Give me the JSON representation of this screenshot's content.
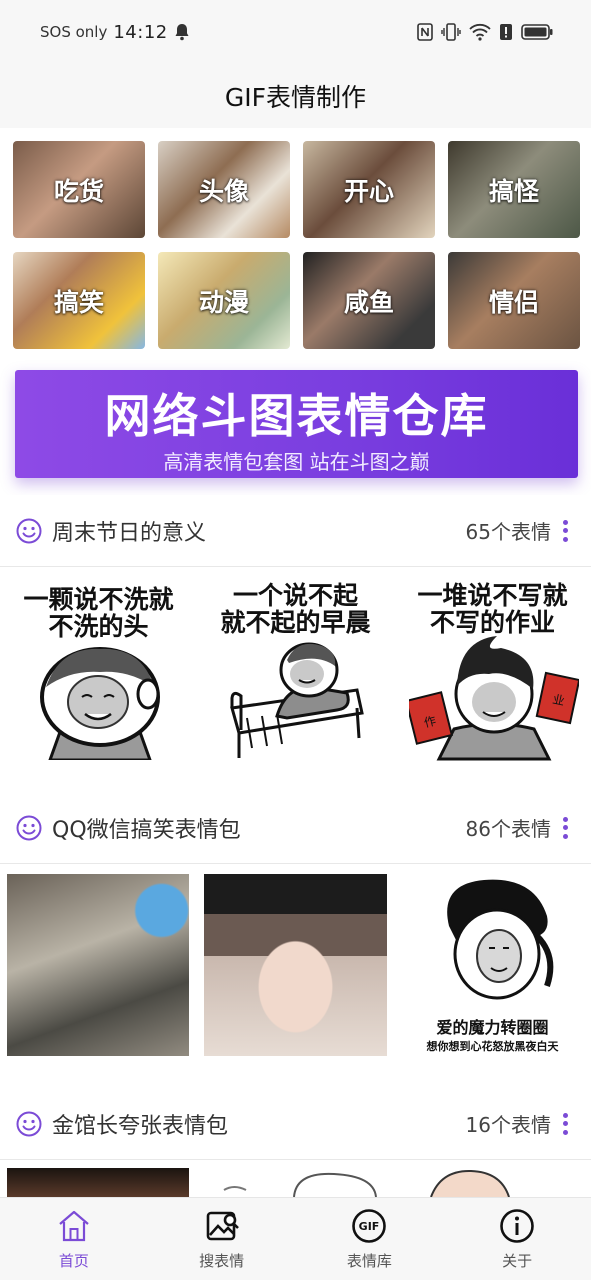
{
  "status_bar": {
    "network": "SOS only",
    "time": "14:12"
  },
  "app_title": "GIF表情制作",
  "categories": [
    {
      "label": "吃货"
    },
    {
      "label": "头像"
    },
    {
      "label": "开心"
    },
    {
      "label": "搞怪"
    },
    {
      "label": "搞笑"
    },
    {
      "label": "动漫"
    },
    {
      "label": "咸鱼"
    },
    {
      "label": "情侣"
    }
  ],
  "banner": {
    "title": "网络斗图表情仓库",
    "subtitle": "高清表情包套图 站在斗图之巅"
  },
  "sections": [
    {
      "title": "周末节日的意义",
      "count": "65个表情",
      "memes": [
        {
          "caption_1": "一颗说不洗就",
          "caption_2": "不洗的头"
        },
        {
          "caption_1": "一个说不起",
          "caption_2": "就不起的早晨"
        },
        {
          "caption_1": "一堆说不写就",
          "caption_2": "不写的作业"
        }
      ]
    },
    {
      "title": "QQ微信搞笑表情包",
      "count": "86个表情",
      "memes": [
        {
          "caption_1": "",
          "caption_2": ""
        },
        {
          "caption_1": "",
          "caption_2": ""
        },
        {
          "caption_1": "爱的魔力转圈圈",
          "caption_2": "想你想到心花怒放黑夜白天"
        }
      ]
    },
    {
      "title": "金馆长夸张表情包",
      "count": "16个表情"
    }
  ],
  "tabs": [
    {
      "label": "首页",
      "icon": "home-icon",
      "active": true
    },
    {
      "label": "搜表情",
      "icon": "image-search-icon",
      "active": false
    },
    {
      "label": "表情库",
      "icon": "gif-icon",
      "active": false
    },
    {
      "label": "关于",
      "icon": "info-icon",
      "active": false
    }
  ],
  "colors": {
    "accent": "#7b4bd6",
    "banner_start": "#8e4ae6",
    "banner_end": "#6a2fd8"
  }
}
